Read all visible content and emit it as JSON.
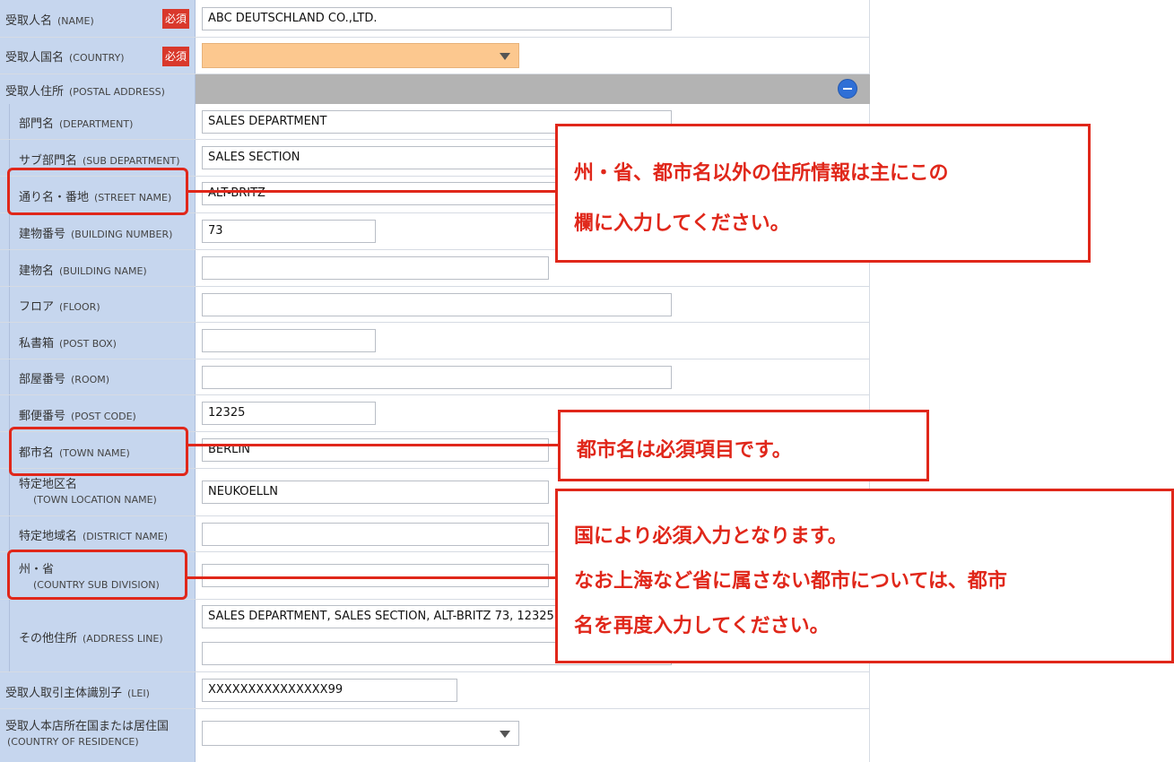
{
  "required_label": "必須",
  "rows": {
    "name": {
      "label": "受取人名",
      "en": "(NAME)",
      "value": "ABC DEUTSCHLAND CO.,LTD."
    },
    "country": {
      "label": "受取人国名",
      "en": "(COUNTRY)",
      "value": ""
    },
    "postal": {
      "label": "受取人住所",
      "en": "(POSTAL ADDRESS)"
    },
    "department": {
      "label": "部門名",
      "en": "(DEPARTMENT)",
      "value": "SALES DEPARTMENT"
    },
    "sub_department": {
      "label": "サブ部門名",
      "en": "(SUB DEPARTMENT)",
      "value": "SALES SECTION"
    },
    "street": {
      "label": "通り名・番地",
      "en": "(STREET NAME)",
      "value": "ALT-BRITZ"
    },
    "building_number": {
      "label": "建物番号",
      "en": "(BUILDING NUMBER)",
      "value": "73"
    },
    "building_name": {
      "label": "建物名",
      "en": "(BUILDING NAME)",
      "value": ""
    },
    "floor": {
      "label": "フロア",
      "en": "(FLOOR)",
      "value": ""
    },
    "post_box": {
      "label": "私書箱",
      "en": "(POST BOX)",
      "value": ""
    },
    "room": {
      "label": "部屋番号",
      "en": "(ROOM)",
      "value": ""
    },
    "post_code": {
      "label": "郵便番号",
      "en": "(POST CODE)",
      "value": "12325"
    },
    "town": {
      "label": "都市名",
      "en": "(TOWN NAME)",
      "value": "BERLIN"
    },
    "town_location": {
      "label": "特定地区名",
      "en": "(TOWN LOCATION NAME)",
      "value": "NEUKOELLN"
    },
    "district": {
      "label": "特定地域名",
      "en": "(DISTRICT NAME)",
      "value": ""
    },
    "subdivision": {
      "label": "州・省",
      "en": "(COUNTRY SUB DIVISION)",
      "value": ""
    },
    "address_line": {
      "label": "その他住所",
      "en": "(ADDRESS LINE)",
      "value1": "SALES DEPARTMENT, SALES SECTION, ALT-BRITZ 73, 12325",
      "value2": ""
    },
    "lei": {
      "label": "受取人取引主体識別子",
      "en": "(LEI)",
      "value": "XXXXXXXXXXXXXXX99"
    },
    "residence": {
      "label": "受取人本店所在国または居住国",
      "en": "(COUNTRY OF RESIDENCE)",
      "value": ""
    }
  },
  "callouts": {
    "street": [
      "州・省、都市名以外の住所情報は主にこの",
      "欄に入力してください。"
    ],
    "town": [
      "都市名は必須項目です。"
    ],
    "subdivision": [
      "国により必須入力となります。",
      "なお上海など省に属さない都市については、都市",
      "名を再度入力してください。"
    ]
  },
  "colors": {
    "label_bg": "#c6d6ee",
    "required_bg": "#d9382b",
    "callout_red": "#e0271a",
    "country_select_bg": "#fcc88f",
    "collapse_button": "#2f6fd6"
  },
  "icons": {
    "collapse": "minus-circle-icon",
    "dropdown": "triangle-down-icon"
  }
}
